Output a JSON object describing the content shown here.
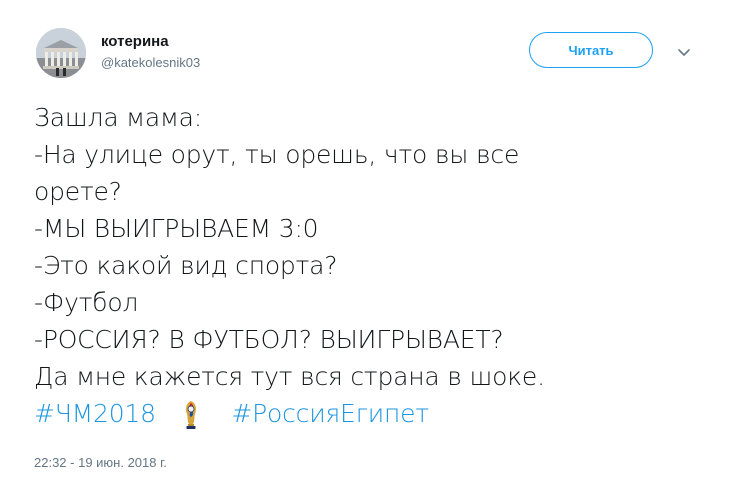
{
  "author": {
    "display_name": "котерина",
    "username": "@katekolesnik03"
  },
  "follow_button_label": "Читать",
  "tweet": {
    "lines": [
      "Зашла мама:",
      "-На улице орут, ты орешь, что вы все",
      "орете?",
      "-МЫ ВЫИГРЫВАЕМ 3:0",
      "-Это какой вид спорта?",
      "-Футбол",
      "-РОССИЯ? В ФУТБОЛ? ВЫИГРЫВАЕТ?",
      "Да мне кажется тут вся страна в шоке."
    ],
    "hashtags": [
      "#ЧМ2018",
      "#РоссияЕгипет"
    ]
  },
  "timestamp": "22:32 - 19 июн. 2018 г.",
  "colors": {
    "link": "#1b95e0",
    "follow": "#1da1f2",
    "secondary_text": "#657786"
  },
  "icons": {
    "avatar": "bolshoi-theatre-photo",
    "caret": "chevron-down-icon",
    "hashtag_emoji": "world-cup-2018-emblem-icon"
  }
}
